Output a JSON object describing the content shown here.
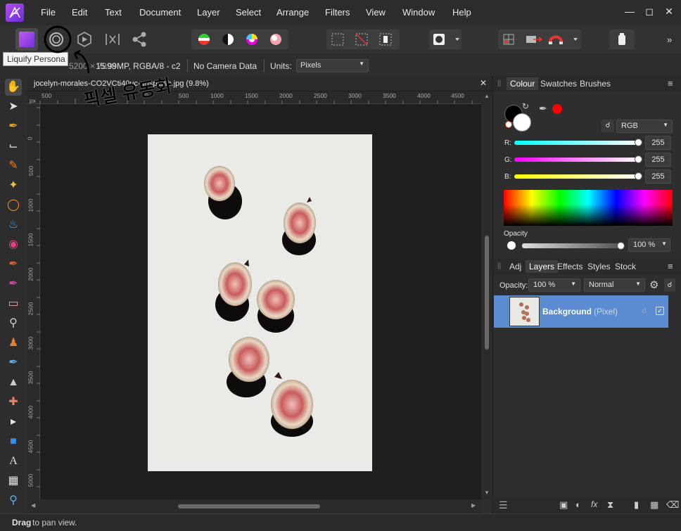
{
  "menu": [
    "File",
    "Edit",
    "Text",
    "Document",
    "Layer",
    "Select",
    "Arrange",
    "Filters",
    "View",
    "Window",
    "Help"
  ],
  "tooltip": "Liquify Persona",
  "context": {
    "pixel_info": "15.99MP, RGBA/8 - c2",
    "camera": "No Camera Data",
    "units_label": "Units:",
    "units_value": "Pixels",
    "partial_left": "5200 × 7998"
  },
  "document": {
    "title": "jocelyn-morales-CO2VCti40uc-unsplash.jpg (9.8%)",
    "ruler_unit": "px",
    "ruler_top": [
      "500",
      "0",
      "500",
      "1000",
      "1500",
      "2000",
      "2500",
      "3000",
      "3500",
      "4000",
      "4500"
    ],
    "ruler_left": [
      "0",
      "500",
      "1000",
      "1500",
      "2000",
      "2500",
      "3000",
      "3500",
      "4000",
      "4500",
      "5000"
    ]
  },
  "annotation": "픽셀 유동화",
  "colour_panel": {
    "tabs": [
      "Colour",
      "Swatches",
      "Brushes"
    ],
    "active_tab": "Colour",
    "model": "RGB",
    "channels": [
      {
        "label": "R:",
        "value": "255",
        "color": "#26e0e0"
      },
      {
        "label": "G:",
        "value": "255",
        "color": "#e030e0"
      },
      {
        "label": "B:",
        "value": "255",
        "color": "#e8e020"
      }
    ],
    "opacity_label": "Opacity",
    "opacity_value": "100 %",
    "fill_color": "#000000",
    "stroke_color": "#ffffff",
    "picked_color": "#ff0000"
  },
  "layers_panel": {
    "tabs": [
      "Adj",
      "Layers",
      "Effects",
      "Styles",
      "Stock"
    ],
    "active_tab": "Layers",
    "opacity_label": "Opacity:",
    "opacity_value": "100 %",
    "blend_mode": "Normal",
    "layers": [
      {
        "name": "Background",
        "type": "(Pixel)",
        "visible": true,
        "locked": true
      }
    ]
  },
  "status": {
    "bold": "Drag",
    "text": " to pan view."
  },
  "accent_color": "#5b8bd0"
}
